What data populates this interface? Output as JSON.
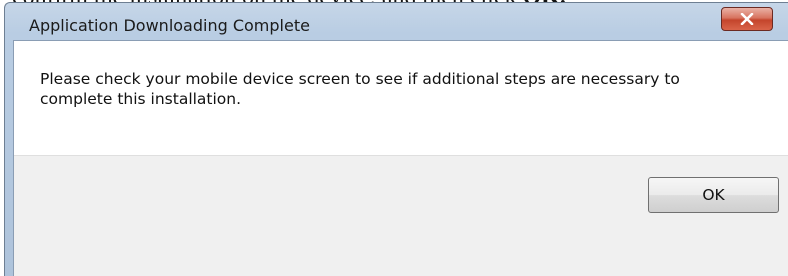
{
  "background_text": {
    "prefix": "confirm the installation on the device, and then click ",
    "bold": "OK."
  },
  "dialog": {
    "title": "Application Downloading Complete",
    "close_icon": "close-icon",
    "message_line_1": "Please check your mobile device screen to see if additional steps are necessary to",
    "message_line_2": "complete this installation.",
    "ok_label": "OK"
  },
  "colors": {
    "close_button": "#c4452c",
    "titlebar": "#b9cde3",
    "footer": "#f0f0f0"
  }
}
